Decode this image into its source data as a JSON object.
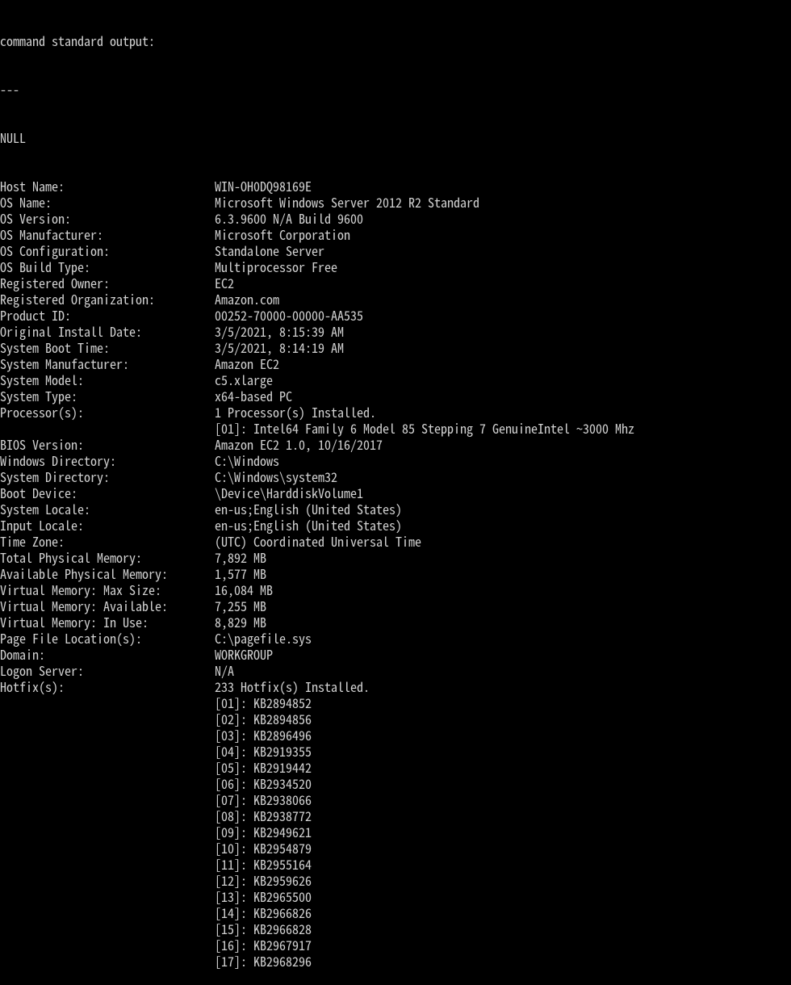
{
  "header": {
    "line1": "command standard output:",
    "line2": "---",
    "line3": "NULL"
  },
  "fields": [
    {
      "label": "Host Name:",
      "value": "WIN-OH0DQ98169E"
    },
    {
      "label": "OS Name:",
      "value": "Microsoft Windows Server 2012 R2 Standard"
    },
    {
      "label": "OS Version:",
      "value": "6.3.9600 N/A Build 9600"
    },
    {
      "label": "OS Manufacturer:",
      "value": "Microsoft Corporation"
    },
    {
      "label": "OS Configuration:",
      "value": "Standalone Server"
    },
    {
      "label": "OS Build Type:",
      "value": "Multiprocessor Free"
    },
    {
      "label": "Registered Owner:",
      "value": "EC2"
    },
    {
      "label": "Registered Organization:",
      "value": "Amazon.com"
    },
    {
      "label": "Product ID:",
      "value": "00252-70000-00000-AA535"
    },
    {
      "label": "Original Install Date:",
      "value": "3/5/2021, 8:15:39 AM"
    },
    {
      "label": "System Boot Time:",
      "value": "3/5/2021, 8:14:19 AM"
    },
    {
      "label": "System Manufacturer:",
      "value": "Amazon EC2"
    },
    {
      "label": "System Model:",
      "value": "c5.xlarge"
    },
    {
      "label": "System Type:",
      "value": "x64-based PC"
    },
    {
      "label": "Processor(s):",
      "value": "1 Processor(s) Installed."
    },
    {
      "label": "",
      "value": "[01]: Intel64 Family 6 Model 85 Stepping 7 GenuineIntel ~3000 Mhz"
    },
    {
      "label": "BIOS Version:",
      "value": "Amazon EC2 1.0, 10/16/2017"
    },
    {
      "label": "Windows Directory:",
      "value": "C:\\Windows"
    },
    {
      "label": "System Directory:",
      "value": "C:\\Windows\\system32"
    },
    {
      "label": "Boot Device:",
      "value": "\\Device\\HarddiskVolume1"
    },
    {
      "label": "System Locale:",
      "value": "en-us;English (United States)"
    },
    {
      "label": "Input Locale:",
      "value": "en-us;English (United States)"
    },
    {
      "label": "Time Zone:",
      "value": "(UTC) Coordinated Universal Time"
    },
    {
      "label": "Total Physical Memory:",
      "value": "7,892 MB"
    },
    {
      "label": "Available Physical Memory:",
      "value": "1,577 MB"
    },
    {
      "label": "Virtual Memory: Max Size:",
      "value": "16,084 MB"
    },
    {
      "label": "Virtual Memory: Available:",
      "value": "7,255 MB"
    },
    {
      "label": "Virtual Memory: In Use:",
      "value": "8,829 MB"
    },
    {
      "label": "Page File Location(s):",
      "value": "C:\\pagefile.sys"
    },
    {
      "label": "Domain:",
      "value": "WORKGROUP"
    },
    {
      "label": "Logon Server:",
      "value": "N/A"
    },
    {
      "label": "Hotfix(s):",
      "value": "233 Hotfix(s) Installed."
    },
    {
      "label": "",
      "value": "[01]: KB2894852"
    },
    {
      "label": "",
      "value": "[02]: KB2894856"
    },
    {
      "label": "",
      "value": "[03]: KB2896496"
    },
    {
      "label": "",
      "value": "[04]: KB2919355"
    },
    {
      "label": "",
      "value": "[05]: KB2919442"
    },
    {
      "label": "",
      "value": "[06]: KB2934520"
    },
    {
      "label": "",
      "value": "[07]: KB2938066"
    },
    {
      "label": "",
      "value": "[08]: KB2938772"
    },
    {
      "label": "",
      "value": "[09]: KB2949621"
    },
    {
      "label": "",
      "value": "[10]: KB2954879"
    },
    {
      "label": "",
      "value": "[11]: KB2955164"
    },
    {
      "label": "",
      "value": "[12]: KB2959626"
    },
    {
      "label": "",
      "value": "[13]: KB2965500"
    },
    {
      "label": "",
      "value": "[14]: KB2966826"
    },
    {
      "label": "",
      "value": "[15]: KB2966828"
    },
    {
      "label": "",
      "value": "[16]: KB2967917"
    },
    {
      "label": "",
      "value": "[17]: KB2968296"
    }
  ]
}
